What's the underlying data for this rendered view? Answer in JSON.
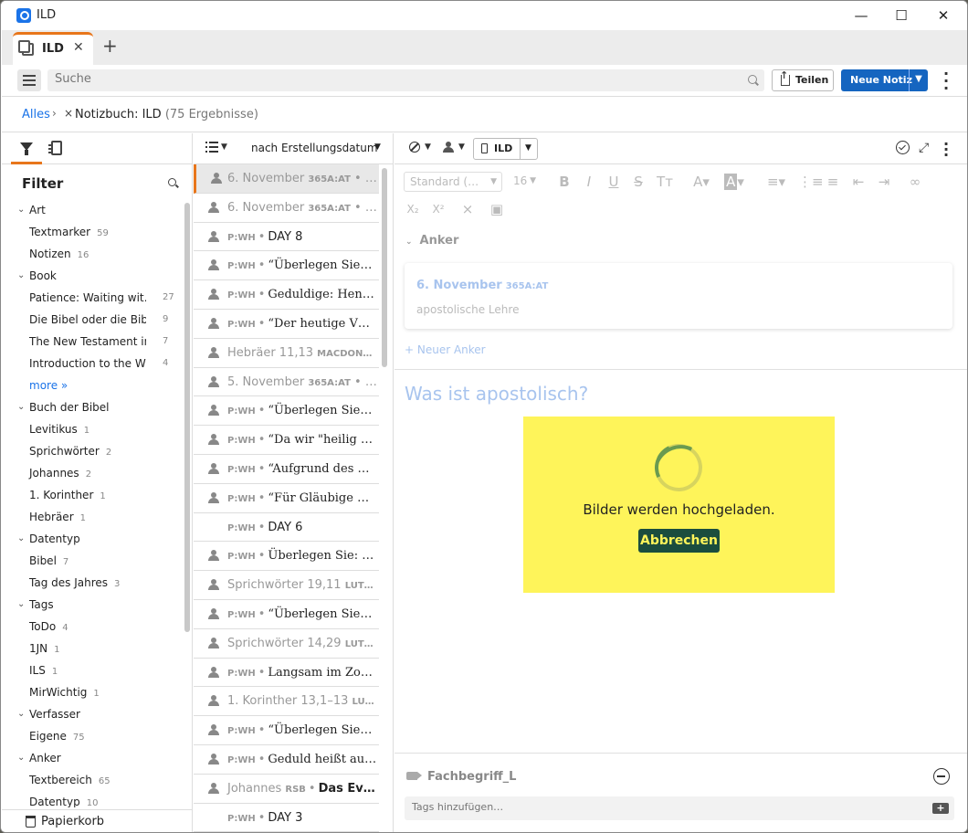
{
  "window": {
    "title": "ILD"
  },
  "tabs": [
    {
      "label": "ILD"
    }
  ],
  "toolbar": {
    "search_placeholder": "Suche",
    "share_label": "Teilen",
    "new_note_label": "Neue Notiz"
  },
  "breadcrumb": {
    "root": "Alles",
    "notebook": "Notizbuch: ILD",
    "count": "(75 Ergebnisse)"
  },
  "filter": {
    "title": "Filter",
    "groups": [
      {
        "label": "Art",
        "items": [
          {
            "label": "Textmarker",
            "count": "59"
          },
          {
            "label": "Notizen",
            "count": "16"
          }
        ]
      },
      {
        "label": "Book",
        "items": [
          {
            "label": "Patience: Waiting wit…",
            "count": "27"
          },
          {
            "label": "Die Bibel oder die Bibe…",
            "count": "9"
          },
          {
            "label": "The New Testament in …",
            "count": "7"
          },
          {
            "label": "Introduction to the Wh…",
            "count": "4"
          }
        ],
        "more": "more »"
      },
      {
        "label": "Buch der Bibel",
        "items": [
          {
            "label": "Levitikus",
            "count": "1"
          },
          {
            "label": "Sprichwörter",
            "count": "2"
          },
          {
            "label": "Johannes",
            "count": "2"
          },
          {
            "label": "1. Korinther",
            "count": "1"
          },
          {
            "label": "Hebräer",
            "count": "1"
          }
        ]
      },
      {
        "label": "Datentyp",
        "items": [
          {
            "label": "Bibel",
            "count": "7"
          },
          {
            "label": "Tag des Jahres",
            "count": "3"
          }
        ]
      },
      {
        "label": "Tags",
        "items": [
          {
            "label": "ToDo",
            "count": "4"
          },
          {
            "label": "1JN",
            "count": "1"
          },
          {
            "label": "ILS",
            "count": "1"
          },
          {
            "label": "MirWichtig",
            "count": "1"
          }
        ]
      },
      {
        "label": "Verfasser",
        "items": [
          {
            "label": "Eigene",
            "count": "75"
          }
        ]
      },
      {
        "label": "Anker",
        "items": [
          {
            "label": "Textbereich",
            "count": "65"
          },
          {
            "label": "Datentyp",
            "count": "10"
          }
        ]
      }
    ],
    "trash_label": "Papierkorb"
  },
  "notelist": {
    "sort_label": "nach Erstellungsdatum",
    "rows": [
      {
        "kind": "ref",
        "main": "6. November",
        "src": "365A:AT",
        "tail": " • …",
        "selected": true,
        "avatar": true
      },
      {
        "kind": "ref",
        "main": "6. November",
        "src": "365A:AT",
        "tail": " • …",
        "avatar": true
      },
      {
        "kind": "pw",
        "pre": "P:WH",
        "text": "DAY 8",
        "style": "sans",
        "avatar": true
      },
      {
        "kind": "pw",
        "pre": "P:WH",
        "text": "“Überlegen Sie…",
        "style": "serif",
        "avatar": true
      },
      {
        "kind": "pw",
        "pre": "P:WH",
        "text": "Geduldige: Hen…",
        "style": "serif",
        "avatar": true
      },
      {
        "kind": "pw",
        "pre": "P:WH",
        "text": "“Der heutige V…",
        "style": "serif",
        "avatar": true
      },
      {
        "kind": "ref",
        "main": "Hebräer 11,13",
        "src": "MACDON…",
        "tail": "",
        "avatar": true
      },
      {
        "kind": "ref",
        "main": "5. November",
        "src": "365A:AT",
        "tail": " • …",
        "avatar": true
      },
      {
        "kind": "pw",
        "pre": "P:WH",
        "text": "“Überlegen Sie…",
        "style": "serif",
        "avatar": true
      },
      {
        "kind": "pw",
        "pre": "P:WH",
        "text": "“Da wir \"heilig …",
        "style": "serif",
        "avatar": true
      },
      {
        "kind": "pw",
        "pre": "P:WH",
        "text": "“Aufgrund des …",
        "style": "serif",
        "avatar": true
      },
      {
        "kind": "pw",
        "pre": "P:WH",
        "text": "“Für Gläubige …",
        "style": "serif",
        "avatar": true
      },
      {
        "kind": "pw",
        "pre": "P:WH",
        "text": "DAY 6",
        "style": "sans",
        "avatar": false
      },
      {
        "kind": "pw",
        "pre": "P:WH",
        "text": "Überlegen Sie: …",
        "style": "serif",
        "avatar": true
      },
      {
        "kind": "ref",
        "main": "Sprichwörter 19,11",
        "src": "LUT…",
        "tail": "",
        "avatar": true
      },
      {
        "kind": "pw",
        "pre": "P:WH",
        "text": "“Überlegen Sie…",
        "style": "serif",
        "avatar": true
      },
      {
        "kind": "ref",
        "main": "Sprichwörter 14,29",
        "src": "LUT…",
        "tail": "",
        "avatar": true
      },
      {
        "kind": "pw",
        "pre": "P:WH",
        "text": "Langsam im Zo…",
        "style": "serif",
        "avatar": true
      },
      {
        "kind": "ref",
        "main": "1. Korinther 13,1–13",
        "src": "LU…",
        "tail": "",
        "avatar": true
      },
      {
        "kind": "pw",
        "pre": "P:WH",
        "text": "“Überlegen Sie…",
        "style": "serif",
        "avatar": true
      },
      {
        "kind": "pw",
        "pre": "P:WH",
        "text": "Geduld heißt au…",
        "style": "serif",
        "avatar": true
      },
      {
        "kind": "jo",
        "main": "Johannes",
        "src": "RSB",
        "text": "Das Ev…",
        "avatar": true
      },
      {
        "kind": "pw",
        "pre": "P:WH",
        "text": "DAY 3",
        "style": "sans",
        "avatar": false
      }
    ]
  },
  "editor": {
    "notebook_label": "ILD",
    "style_select": "Standard (…",
    "size_select": "16",
    "anchor_heading": "Anker",
    "anchor": {
      "title": "6. November",
      "src": "365A:AT",
      "sub": "apostolische Lehre"
    },
    "new_anchor": "+ Neuer Anker",
    "note_title": "Was ist apostolisch?",
    "upload_message": "Bilder werden hochgeladen.",
    "cancel_label": "Abbrechen",
    "tag_name": "Fachbegriff_L",
    "tag_input_placeholder": "Tags hinzufügen…"
  }
}
